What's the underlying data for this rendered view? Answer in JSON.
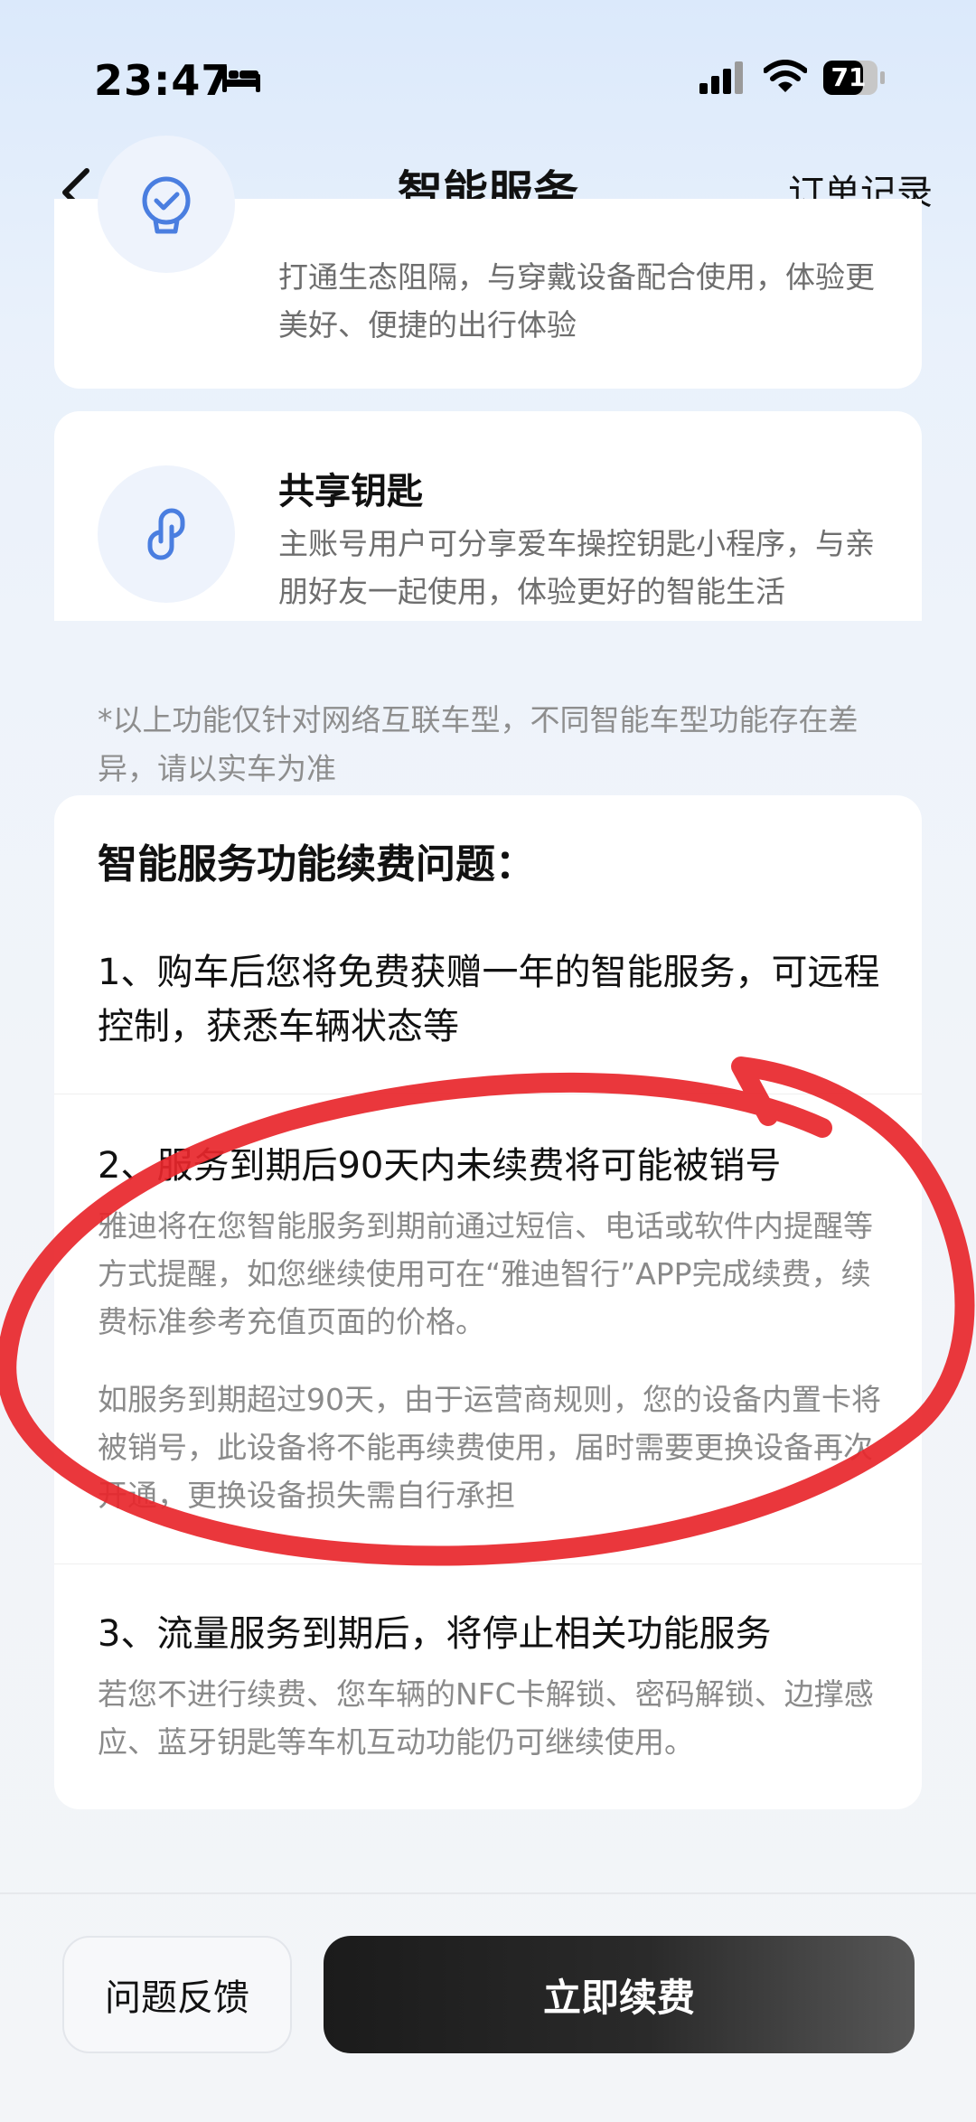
{
  "status_bar": {
    "time": "23:47",
    "battery": "71",
    "icons": [
      "bed-icon",
      "signal-icon",
      "wifi-icon",
      "battery-icon"
    ]
  },
  "nav": {
    "title": "智能服务",
    "right_link": "订单记录",
    "back_icon": "chevron-left-icon"
  },
  "features": [
    {
      "icon": "watch-icon",
      "desc": "打通生态阻隔，与穿戴设备配合使用，体验更美好、便捷的出行体验"
    },
    {
      "icon": "link-key-icon",
      "title": "共享钥匙",
      "desc": "主账号用户可分享爱车操控钥匙小程序，与亲朋好友一起使用，体验更好的智能生活"
    }
  ],
  "disclaimer": "*以上功能仅针对网络互联车型，不同智能车型功能存在差异，请以实车为准",
  "faq": {
    "heading": "智能服务功能续费问题：",
    "items": [
      {
        "question": "1、购车后您将免费获赠一年的智能服务，可远程控制，获悉车辆状态等"
      },
      {
        "question": "2、服务到期后90天内未续费将可能被销号",
        "answer_1": "雅迪将在您智能服务到期前通过短信、电话或软件内提醒等方式提醒，如您继续使用可在“雅迪智行”APP完成续费，续费标准参考充值页面的价格。",
        "answer_2": "如服务到期超过90天，由于运营商规则，您的设备内置卡将被销号，此设备将不能再续费使用，届时需要更换设备再次开通，更换设备损失需自行承担"
      },
      {
        "question": "3、流量服务到期后，将停止相关功能服务",
        "answer_1": "若您不进行续费、您车辆的NFC卡解锁、密码解锁、边撑感应、蓝牙钥匙等车机互动功能仍可继续使用。"
      }
    ]
  },
  "bottom_bar": {
    "feedback_label": "问题反馈",
    "renew_label": "立即续费"
  },
  "colors": {
    "annotation_red": "#e8262b",
    "icon_blue": "#4a7ee0",
    "renew_button": "#1b1b1b"
  }
}
